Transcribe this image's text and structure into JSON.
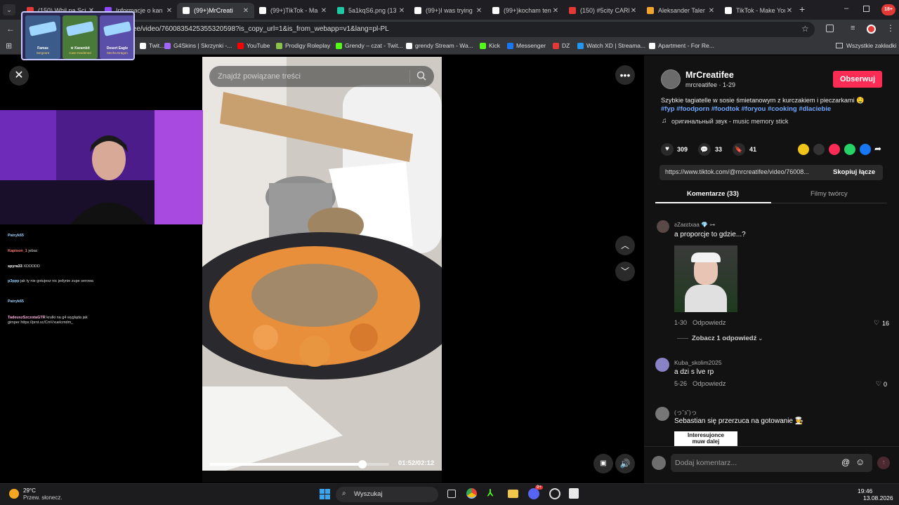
{
  "tabs": [
    {
      "title": "(150) Whil pa Sci",
      "icon_color": "#e53935",
      "active": false
    },
    {
      "title": "Informacje o kan",
      "icon_color": "#9147ff",
      "active": false
    },
    {
      "title": "(99+)MrCreati",
      "icon_color": "#ffffff",
      "active": true
    },
    {
      "title": "(99+)TikTok - Ma",
      "icon_color": "#ffffff",
      "active": false
    },
    {
      "title": "5a1kqS6.png (13",
      "icon_color": "#1ec8a5",
      "active": false
    },
    {
      "title": "(99+)I was trying",
      "icon_color": "#ffffff",
      "active": false
    },
    {
      "title": "(99+)kocham ten",
      "icon_color": "#ffffff",
      "active": false
    },
    {
      "title": "(150) #5city CARE",
      "icon_color": "#e53935",
      "active": false
    },
    {
      "title": "Aleksander Taler",
      "icon_color": "#f4a62a",
      "active": false
    },
    {
      "title": "TikTok - Make You",
      "icon_color": "#ffffff",
      "active": false
    }
  ],
  "browser": {
    "url": "fee/video/7600835425355320598?is_copy_url=1&is_from_webapp=v1&lang=pl-PL",
    "new_tab": "+",
    "tab_close": "✕",
    "profile_badge": "18+"
  },
  "bookmarks": [
    {
      "label": "Twit...",
      "color": "#ffffff"
    },
    {
      "label": "G4Skins | Skrzynki -...",
      "color": "#a066ff"
    },
    {
      "label": "YouTube",
      "color": "#ff0000"
    },
    {
      "label": "Prodigy Roleplay",
      "color": "#8bc34a"
    },
    {
      "label": "Grendy – czat - Twit...",
      "color": "#53fc18"
    },
    {
      "label": "grendy Stream - Wa...",
      "color": "#ffffff"
    },
    {
      "label": "Kick",
      "color": "#53fc18"
    },
    {
      "label": "Messenger",
      "color": "#1877f2"
    },
    {
      "label": "DZ",
      "color": "#e53935"
    },
    {
      "label": "Watch XD | Streama...",
      "color": "#2196f3"
    },
    {
      "label": "Apartment - For Re...",
      "color": "#ffffff"
    }
  ],
  "all_bookmarks": "Wszystkie zakładki",
  "overlay": {
    "cards": [
      {
        "name": "Famas",
        "sub": "Sergeant"
      },
      {
        "name": "★ Karambit",
        "sub": "Case Hardened"
      },
      {
        "name": "Desert Eagle",
        "sub": "Mecha Dragon"
      }
    ]
  },
  "stream_chat": [
    {
      "user": "Patryk65",
      "text": "",
      "color": "#9ad0ff"
    },
    {
      "user": "Kapison_1",
      "text": "jebac",
      "color": "#ff7a7a"
    },
    {
      "user": "spyra33",
      "text": "XDDDDD",
      "color": "#ffffff"
    },
    {
      "user": "p3ppp",
      "text": "jak ty nie gotujesz nic jedynie zupe serowa",
      "color": "#8fd3ff"
    },
    {
      "user": "Patryk65",
      "text": "",
      "color": "#9ad0ff"
    },
    {
      "user": "TadeuszSzczotaGTR",
      "text": "krulki na g4 wygląda jak gimper https://prnt.sc/CmVxuelcmdm_",
      "color": "#ffb3e0"
    }
  ],
  "video": {
    "search_placeholder": "Znajdź powiązane treści",
    "time": "01:52/02:12",
    "progress": 0.85
  },
  "author": {
    "display_name": "MrCreatifee",
    "handle_date": "mrcreatifee · 1-29",
    "follow": "Obserwuj"
  },
  "post": {
    "caption": "Szybkie tagiatelle w sosie śmietanowym z kurczakiem i pieczarkami 🤤",
    "hashtags": "#fyp #foodporn #foodtok #foryou #cooking #dlaciebie",
    "sound": "оригинальный звук - music memory stick"
  },
  "stats": {
    "likes": "309",
    "comments": "33",
    "saves": "41"
  },
  "share_colors": [
    "#f0c419",
    "#333333",
    "#fe2c55",
    "#25d366",
    "#1877f2"
  ],
  "link": {
    "url": "https://www.tiktok.com/@mrcreatifee/video/76008...",
    "copy": "Skopiuj łącze"
  },
  "tabs_panel": {
    "comments": "Komentarze (33)",
    "creator": "Filmy twórcy"
  },
  "comments": [
    {
      "user": "ƨZaɛɛtxaa 💎 ⊶",
      "text": "a proporcje to gdzie...?",
      "date": "1-30",
      "reply": "Odpowiedz",
      "likes": "16",
      "see_replies": "Zobacz 1 odpowiedź"
    },
    {
      "user": "Kuba_skolim2025",
      "text": "a dzi s lve rp",
      "date": "5-26",
      "reply": "Odpowiedz",
      "likes": "0"
    },
    {
      "user": "(っ˘з˘)っ",
      "text": "Sebastian się przerzuca na gotowanie 🧑‍🍳",
      "sticker": "Interesujonce muw dalej"
    }
  ],
  "comment_input": {
    "placeholder": "Dodaj komentarz..."
  },
  "taskbar": {
    "weather_temp": "29°C",
    "weather_text": "Przew. słonecz.",
    "search": "Wyszukaj",
    "time": "19:46",
    "date": "13.08.2026",
    "discord_badge": "9+"
  }
}
